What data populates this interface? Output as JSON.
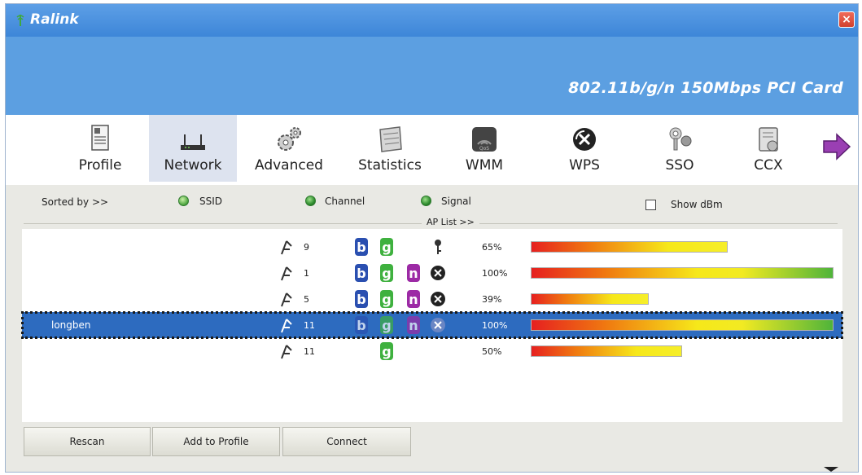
{
  "window": {
    "title": "Ralink",
    "subtitle": "802.11b/g/n  150Mbps  PCI  Card",
    "close_label": "×"
  },
  "toolbar": {
    "items": [
      {
        "label": "Profile",
        "icon": "profile-icon",
        "active": false
      },
      {
        "label": "Network",
        "icon": "network-icon",
        "active": true
      },
      {
        "label": "Advanced",
        "icon": "advanced-icon",
        "active": false
      },
      {
        "label": "Statistics",
        "icon": "statistics-icon",
        "active": false
      },
      {
        "label": "WMM",
        "icon": "wmm-icon",
        "active": false
      },
      {
        "label": "WPS",
        "icon": "wps-icon",
        "active": false
      },
      {
        "label": "SSO",
        "icon": "sso-icon",
        "active": false
      },
      {
        "label": "CCX",
        "icon": "ccx-icon",
        "active": false
      }
    ],
    "next_icon": "arrow-right-icon"
  },
  "sort": {
    "label": "Sorted by >>",
    "options": [
      {
        "label": "SSID",
        "selected": false
      },
      {
        "label": "Channel",
        "selected": true
      },
      {
        "label": "Signal",
        "selected": true
      }
    ],
    "show_dbm_label": "Show dBm",
    "show_dbm_checked": false
  },
  "ap_list": {
    "label": "AP List >>",
    "rows": [
      {
        "ssid": "",
        "channel": "9",
        "b": "b",
        "g": "g",
        "n": "",
        "security": "key",
        "signal_pct": "65%",
        "signal_level": 0.65,
        "selected": false
      },
      {
        "ssid": "",
        "channel": "1",
        "b": "b",
        "g": "g",
        "n": "n",
        "security": "wps",
        "signal_pct": "100%",
        "signal_level": 1.0,
        "selected": false
      },
      {
        "ssid": "",
        "channel": "5",
        "b": "b",
        "g": "g",
        "n": "n",
        "security": "wps",
        "signal_pct": "39%",
        "signal_level": 0.39,
        "selected": false
      },
      {
        "ssid": "longben",
        "channel": "11",
        "b": "b",
        "g": "g",
        "n": "n",
        "security": "wps",
        "signal_pct": "100%",
        "signal_level": 1.0,
        "selected": true
      },
      {
        "ssid": "",
        "channel": "11",
        "b": "",
        "g": "g",
        "n": "",
        "security": "",
        "signal_pct": "50%",
        "signal_level": 0.5,
        "selected": false
      }
    ]
  },
  "buttons": {
    "rescan": "Rescan",
    "add_to_profile": "Add to Profile",
    "connect": "Connect"
  },
  "colors": {
    "title_bar": "#3d86d8",
    "banner": "#5c9fe1",
    "selection": "#2d6bbf",
    "panel": "#e9e9e4"
  }
}
